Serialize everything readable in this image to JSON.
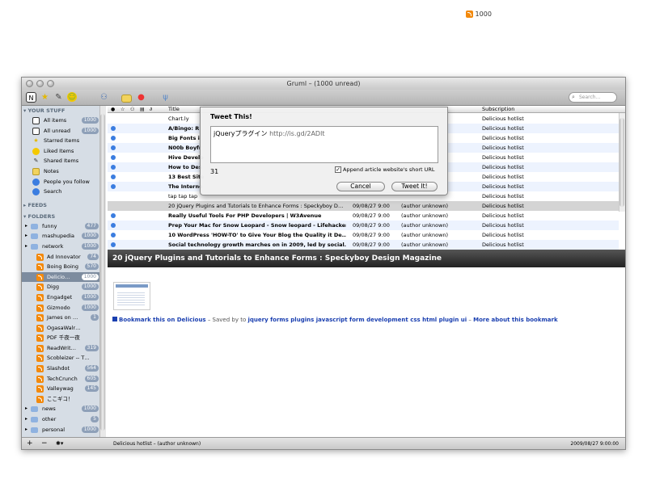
{
  "top_feed": {
    "count": "1000"
  },
  "window": {
    "title": "Gruml – (1000 unread)"
  },
  "toolbar": {
    "search_placeholder": "Search…"
  },
  "sidebar": {
    "your_stuff_header": "YOUR STUFF",
    "your_stuff": [
      {
        "label": "All items",
        "count": "1000",
        "icon": "all-items-icon"
      },
      {
        "label": "All unread",
        "count": "1000",
        "icon": "unread-icon"
      },
      {
        "label": "Starred Items",
        "icon": "star-icon"
      },
      {
        "label": "Liked Items",
        "icon": "smiley-icon"
      },
      {
        "label": "Shared Items",
        "icon": "share-icon"
      },
      {
        "label": "Notes",
        "icon": "note-icon"
      },
      {
        "label": "People you follow",
        "icon": "people-icon"
      },
      {
        "label": "Search",
        "icon": "search-icon"
      }
    ],
    "feeds_header": "FEEDS",
    "folders_header": "FOLDERS",
    "folders": [
      {
        "label": "funny",
        "count": "477",
        "type": "folder",
        "level": 0
      },
      {
        "label": "mashupedia",
        "count": "1000",
        "type": "folder",
        "level": 0
      },
      {
        "label": "network",
        "count": "1000",
        "type": "folder",
        "level": 0
      },
      {
        "label": "Ad Innovator",
        "count": "74",
        "type": "feed",
        "level": 1
      },
      {
        "label": "Boing Boing",
        "count": "570",
        "type": "feed",
        "level": 1
      },
      {
        "label": "Delicio…",
        "count": "1000",
        "type": "feed",
        "level": 1,
        "selected": true
      },
      {
        "label": "Digg",
        "count": "1000",
        "type": "feed",
        "level": 1
      },
      {
        "label": "Engadget",
        "count": "1000",
        "type": "feed",
        "level": 1
      },
      {
        "label": "Gizmodo",
        "count": "1000",
        "type": "feed",
        "level": 1
      },
      {
        "label": "James on …",
        "count": "1",
        "type": "feed",
        "level": 1
      },
      {
        "label": "OgasaWalr…",
        "count": "",
        "type": "feed",
        "level": 1
      },
      {
        "label": "PDF 千夜一夜",
        "count": "",
        "type": "feed",
        "level": 1
      },
      {
        "label": "ReadWrit…",
        "count": "319",
        "type": "feed",
        "level": 1
      },
      {
        "label": "Scobleizer -- T…",
        "count": "",
        "type": "feed",
        "level": 1
      },
      {
        "label": "Slashdot",
        "count": "564",
        "type": "feed",
        "level": 1
      },
      {
        "label": "TechCrunch",
        "count": "605",
        "type": "feed",
        "level": 1
      },
      {
        "label": "Valleywag",
        "count": "145",
        "type": "feed",
        "level": 1
      },
      {
        "label": "ここギコ！",
        "count": "",
        "type": "feed",
        "level": 1
      },
      {
        "label": "news",
        "count": "1000",
        "type": "folder",
        "level": 0
      },
      {
        "label": "other",
        "count": "5",
        "type": "folder",
        "level": 0
      },
      {
        "label": "personal",
        "count": "1000",
        "type": "folder",
        "level": 0
      }
    ]
  },
  "list": {
    "columns": {
      "title": "Title",
      "subscription": "Subscription"
    },
    "rows": [
      {
        "title": "Chart.ly",
        "date": "",
        "author": "",
        "sub": "Delicious hotlist",
        "unread": false
      },
      {
        "title": "A/Bingo: R",
        "date": "",
        "author": "",
        "sub": "Delicious hotlist",
        "unread": true
      },
      {
        "title": "Big Fonts i",
        "date": "",
        "author": "",
        "sub": "Delicious hotlist",
        "unread": true
      },
      {
        "title": "N00b Boyfr",
        "date": "",
        "author": "",
        "sub": "Delicious hotlist",
        "unread": true
      },
      {
        "title": "Hive Develo",
        "date": "",
        "author": "",
        "sub": "Delicious hotlist",
        "unread": true
      },
      {
        "title": "How to Des",
        "date": "",
        "author": "",
        "sub": "Delicious hotlist",
        "unread": true
      },
      {
        "title": "13 Best Site",
        "date": "",
        "author": "",
        "sub": "Delicious hotlist",
        "unread": true
      },
      {
        "title": "The Interne",
        "date": "",
        "author": "",
        "sub": "Delicious hotlist",
        "unread": true
      },
      {
        "title": "tap tap tap",
        "date": "",
        "author": "",
        "sub": "Delicious hotlist",
        "unread": false
      },
      {
        "title": "20 jQuery Plugins and Tutorials to Enhance Forms : Speckyboy D…",
        "date": "09/08/27 9:00",
        "author": "(author unknown)",
        "sub": "Delicious hotlist",
        "unread": false,
        "selected": true
      },
      {
        "title": "Really Useful Tools For PHP Developers | W3Avenue",
        "date": "09/08/27 9:00",
        "author": "(author unknown)",
        "sub": "Delicious hotlist",
        "unread": true
      },
      {
        "title": "Prep Your Mac for Snow Leopard - Snow leopard - Lifehacker",
        "date": "09/08/27 9:00",
        "author": "(author unknown)",
        "sub": "Delicious hotlist",
        "unread": true
      },
      {
        "title": "10 WordPress 'HOW-TO' to Give Your Blog the Quality it De…",
        "date": "09/08/27 9:00",
        "author": "(author unknown)",
        "sub": "Delicious hotlist",
        "unread": true
      },
      {
        "title": "Social technology growth marches on in 2009, led by social…",
        "date": "09/08/27 9:00",
        "author": "(author unknown)",
        "sub": "Delicious hotlist",
        "unread": true
      }
    ]
  },
  "article": {
    "title": "20 jQuery Plugins and Tutorials to Enhance Forms : Speckyboy Design Magazine",
    "bookmark_link": "Bookmark this on Delicious",
    "saved_by": " – Saved by ",
    "to": " to ",
    "tags": "jquery forms plugins javascript form development css html plugin ui",
    "sep": " – ",
    "more": "More about this bookmark"
  },
  "status": {
    "left": "Delicious hotlist – (author unknown)",
    "right": "2009/08/27 9:00:00"
  },
  "tweet_dialog": {
    "title": "Tweet This!",
    "text": "jQueryプラグイン ",
    "url": "http://is.gd/2ADlt",
    "count": "31",
    "append_label": "Append article website's short URL",
    "cancel": "Cancel",
    "tweet": "Tweet It!"
  }
}
